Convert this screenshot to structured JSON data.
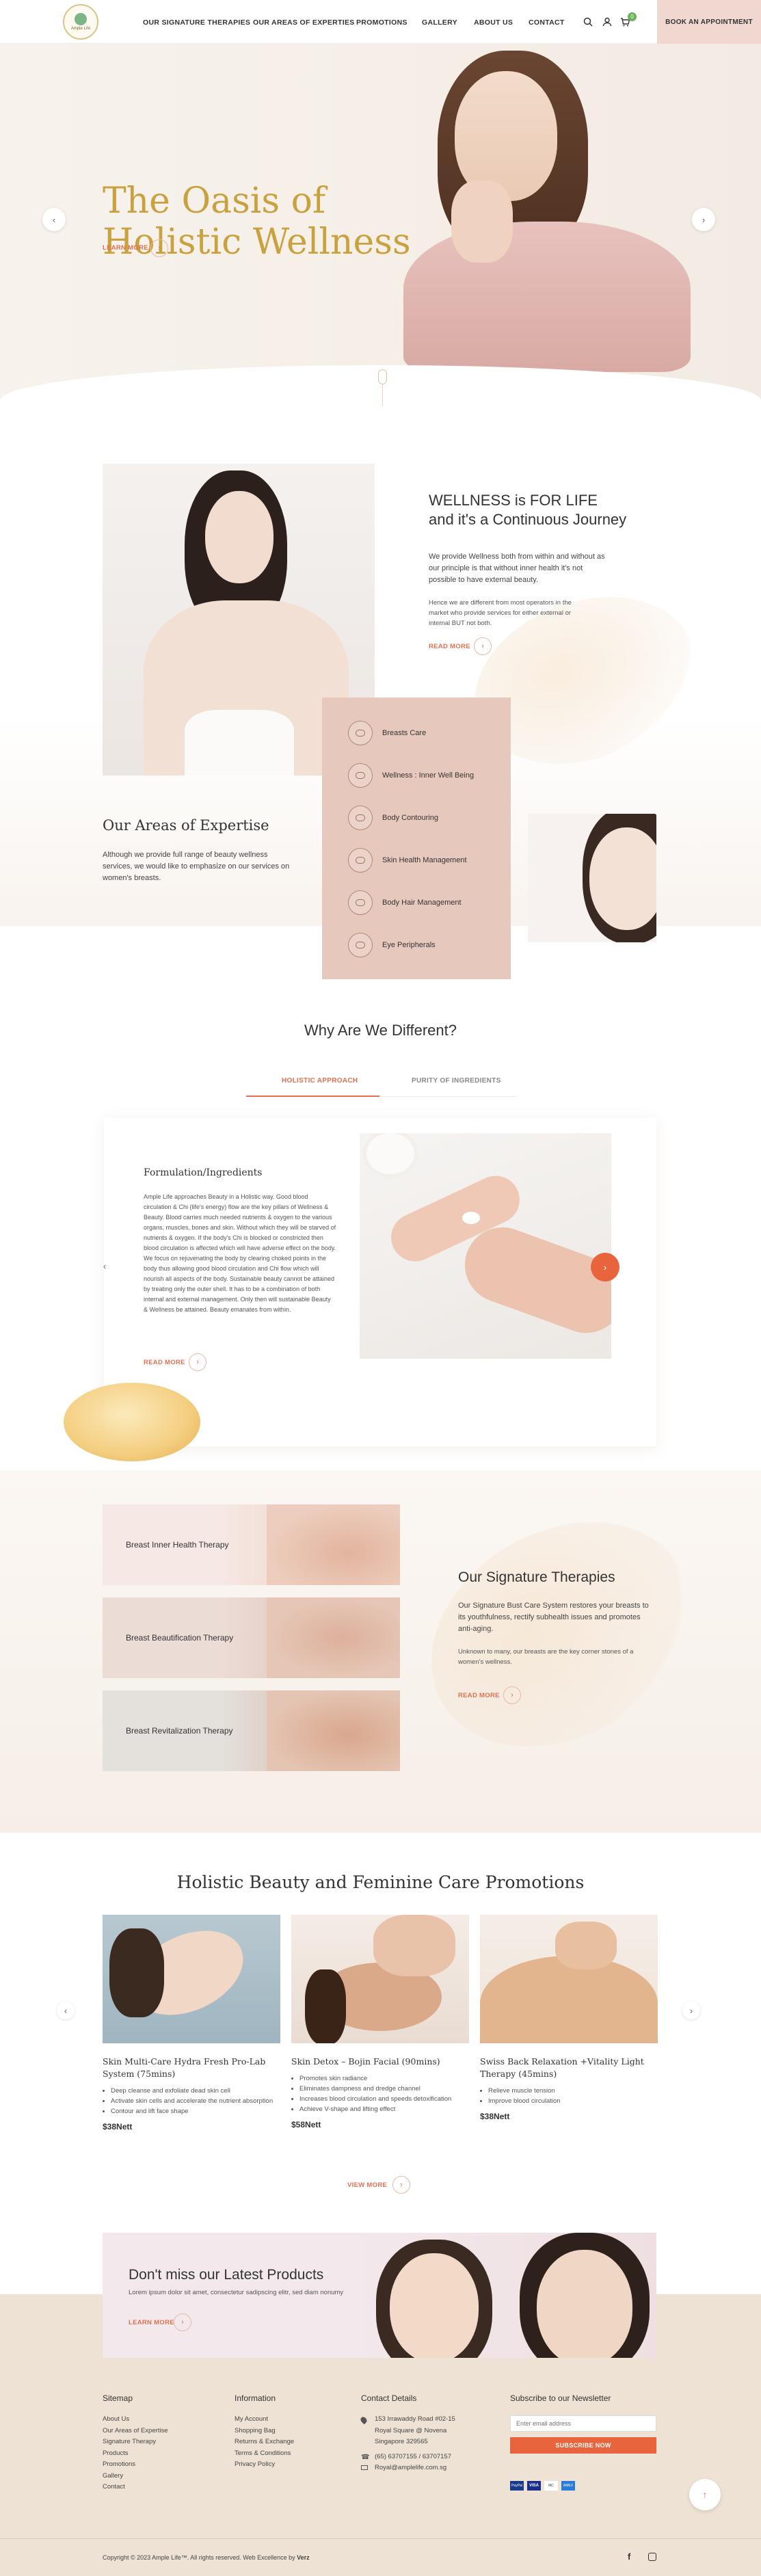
{
  "header": {
    "logo_text": "Ample Life",
    "nav": [
      "OUR SIGNATURE THERAPIES",
      "OUR AREAS OF EXPERTIES",
      "PROMOTIONS",
      "GALLERY",
      "ABOUT US",
      "CONTACT"
    ],
    "cart_count": "0",
    "appointment_label": "BOOK AN APPOINTMENT"
  },
  "hero": {
    "title_line1": "The Oasis of",
    "title_line2": "Holistic Wellness",
    "learn_more": "LEARN MORE",
    "prev": "‹",
    "next": "›"
  },
  "wellness": {
    "title_line1": "WELLNESS is FOR LIFE",
    "title_line2": "and it's a Continuous Journey",
    "para1": "We provide Wellness both from within and without as our principle is that without inner health it's not possible to have external beauty.",
    "para2": "Hence we are different from most operators in the market who provide services for either external or internal BUT not both.",
    "read_more": "READ MORE"
  },
  "expertise": {
    "title": "Our Areas of Expertise",
    "text": "Although we provide full range of beauty wellness services, we would like to emphasize on our services on women's breasts.",
    "items": [
      "Breasts Care",
      "Wellness : Inner Well Being",
      "Body Contouring",
      "Skin Health Management",
      "Body Hair Management",
      "Eye Peripherals"
    ]
  },
  "why": {
    "title": "Why Are We Different?",
    "tabs": [
      "HOLISTIC APPROACH",
      "PURITY OF INGREDIENTS"
    ],
    "card_title": "Formulation/Ingredients",
    "card_text": "Ample Life approaches Beauty in a Holistic way. Good blood circulation & Chi (life's energy) flow are the key pillars of Wellness & Beauty. Blood carries much needed nutrients & oxygen to the various organs, muscles, bones and skin. Without which they will be starved of nutrients & oxygen. If the body's Chi is blocked or constricted then blood circulation is affected which will have adverse effect on the body. We focus on rejuvenating the body by clearing choked points in the body thus allowing good blood circulation and Chi flow which will nourish all aspects of the body. Sustainable beauty cannot be attained by treating only the outer shell. It has to be a combination of both internal and external management. Only then will sustainable Beauty & Wellness be attained. Beauty emanates from within.",
    "read_more": "READ MORE"
  },
  "signature": {
    "rows": [
      "Breast Inner Health Therapy",
      "Breast Beautification Therapy",
      "Breast Revitalization Therapy"
    ],
    "title": "Our Signature Therapies",
    "para1": "Our Signature Bust Care System restores your breasts to its youthfulness, rectify subhealth issues and promotes anti-aging.",
    "para2": "Unknown to many, our breasts are the key corner stones of a women's wellness.",
    "read_more": "READ MORE"
  },
  "promotions": {
    "title": "Holistic Beauty and Feminine Care Promotions",
    "cards": [
      {
        "name": "Skin Multi-Care Hydra Fresh Pro-Lab System (75mins)",
        "points": [
          "Deep cleanse and exfoliate dead skin cell",
          "Activate skin cells and accelerate the nutrient absorption",
          "Contour and lift face shape"
        ],
        "price": "$38Nett"
      },
      {
        "name": "Skin Detox – Bojin Facial (90mins)",
        "points": [
          "Promotes skin radiance",
          "Eliminates dampness and dredge channel",
          "Increases blood circulation and speeds detoxification",
          "Achieve V-shape and lifting effect"
        ],
        "price": "$58Nett"
      },
      {
        "name": "Swiss Back Relaxation +Vitality Light Therapy (45mins)",
        "points": [
          "Relieve muscle tension",
          "Improve blood circulation"
        ],
        "price": "$38Nett"
      }
    ],
    "view_more": "VIEW MORE"
  },
  "banner": {
    "title": "Don't miss our Latest Products",
    "text": "Lorem ipsum dolor sit amet, consectetur sadipscing elitr, sed diam nonumy",
    "learn_more": "LEARN MORE"
  },
  "footer": {
    "sitemap_title": "Sitemap",
    "sitemap": [
      "About Us",
      "Our Areas of Expertise",
      "Signature Therapy",
      "Products",
      "Promotions",
      "Gallery",
      "Contact"
    ],
    "info_title": "Information",
    "info": [
      "My Account",
      "Shopping Bag",
      "Returns & Exchange",
      "Terms & Conditions",
      "Privacy Policy"
    ],
    "contact_title": "Contact Details",
    "address": [
      "153 Irrawaddy Road #02-15",
      "Royal Square @ Novena",
      "Singapore 329565"
    ],
    "phone": "(65) 63707155 / 63707157",
    "email": "Royal@amplelife.com.sg",
    "newsletter_title": "Subscribe to our Newsletter",
    "email_placeholder": "Enter email address",
    "subscribe": "SUBSCRIBE NOW",
    "payments": [
      "PayPal",
      "VISA",
      "MC",
      "AMEX"
    ],
    "copyright": "Copyright © 2023 Ample Life™. All rights reserved. Web Excellence by",
    "agency": "Verz"
  },
  "colors": {
    "accent": "#e07050",
    "gold": "#c9a23f",
    "card": "#e7c8bd",
    "footer": "#ede2d4"
  }
}
